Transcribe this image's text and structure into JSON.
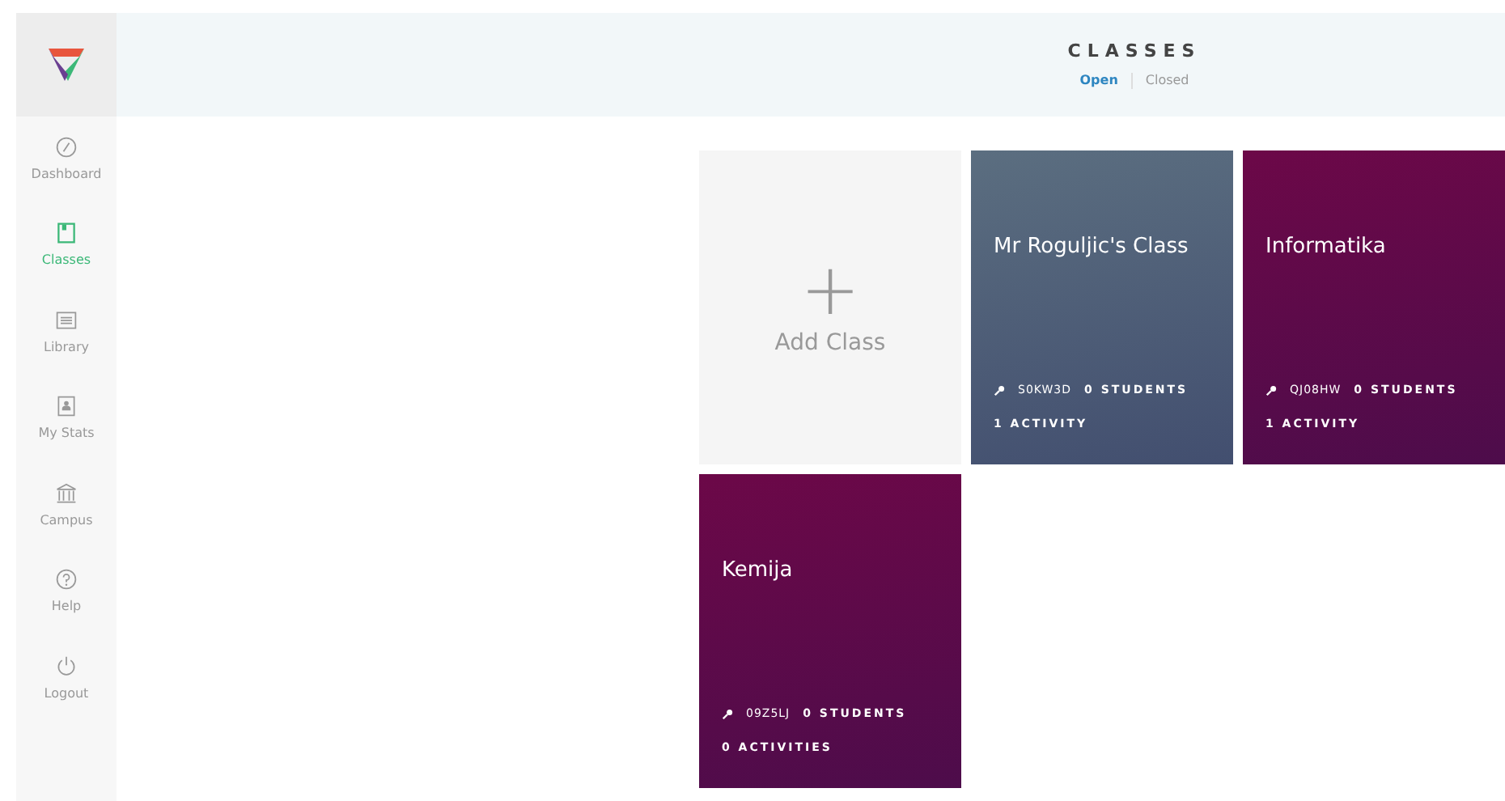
{
  "sidebar": {
    "items": [
      {
        "label": "Dashboard",
        "kind": "gauge",
        "selected": false
      },
      {
        "label": "Classes",
        "kind": "book",
        "selected": true
      },
      {
        "label": "Library",
        "kind": "list",
        "selected": false
      },
      {
        "label": "My Stats",
        "kind": "person",
        "selected": false
      },
      {
        "label": "Campus",
        "kind": "building",
        "selected": false
      },
      {
        "label": "Help",
        "kind": "help",
        "selected": false
      },
      {
        "label": "Logout",
        "kind": "power",
        "selected": false
      }
    ]
  },
  "header": {
    "title": "CLASSES",
    "filters": [
      {
        "label": "Open",
        "selected": true
      },
      {
        "label": "Closed",
        "selected": false
      }
    ]
  },
  "add_card": {
    "icon": "+",
    "label": "Add Class"
  },
  "classes": [
    {
      "name": "Mr Roguljic's Class",
      "code": "S0KW3D",
      "students": "0 STUDENTS",
      "activities": "1 ACTIVITY",
      "color": "#5b6e80"
    },
    {
      "name": "Informatika",
      "code": "QJ08HW",
      "students": "0 STUDENTS",
      "activities": "1 ACTIVITY",
      "color": "#6c0848"
    },
    {
      "name": "Kemija",
      "code": "09Z5LJ",
      "students": "0 STUDENTS",
      "activities": "0 ACTIVITIES",
      "color": "#6c0848"
    }
  ]
}
